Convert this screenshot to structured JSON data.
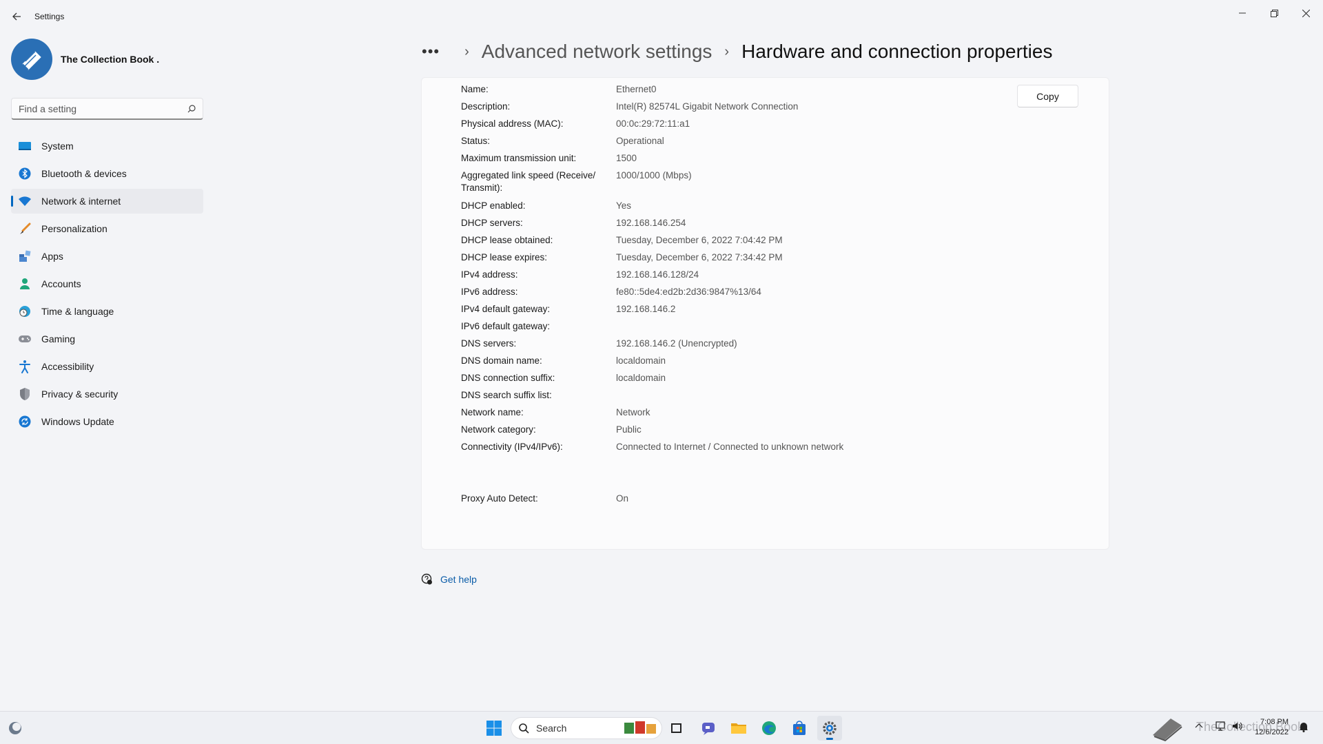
{
  "window": {
    "title": "Settings"
  },
  "profile": {
    "name": "The Collection Book ."
  },
  "search": {
    "placeholder": "Find a setting"
  },
  "nav": {
    "items": [
      {
        "label": "System",
        "icon": "monitor-icon"
      },
      {
        "label": "Bluetooth & devices",
        "icon": "bluetooth-icon"
      },
      {
        "label": "Network & internet",
        "icon": "wifi-icon",
        "active": true
      },
      {
        "label": "Personalization",
        "icon": "brush-icon"
      },
      {
        "label": "Apps",
        "icon": "apps-icon"
      },
      {
        "label": "Accounts",
        "icon": "person-icon"
      },
      {
        "label": "Time & language",
        "icon": "globe-clock-icon"
      },
      {
        "label": "Gaming",
        "icon": "gamepad-icon"
      },
      {
        "label": "Accessibility",
        "icon": "accessibility-icon"
      },
      {
        "label": "Privacy & security",
        "icon": "shield-icon"
      },
      {
        "label": "Windows Update",
        "icon": "update-icon"
      }
    ]
  },
  "breadcrumb": {
    "dots": "•••",
    "parent": "Advanced network settings",
    "current": "Hardware and connection properties"
  },
  "card": {
    "copy_label": "Copy",
    "properties": [
      {
        "label": "Name:",
        "value": "Ethernet0"
      },
      {
        "label": "Description:",
        "value": "Intel(R) 82574L Gigabit Network Connection"
      },
      {
        "label": "Physical address (MAC):",
        "value": "00:0c:29:72:11:a1"
      },
      {
        "label": "Status:",
        "value": "Operational"
      },
      {
        "label": "Maximum transmission unit:",
        "value": "1500"
      },
      {
        "label": "Aggregated link speed (Receive/ Transmit):",
        "value": "1000/1000 (Mbps)"
      },
      {
        "label": "DHCP enabled:",
        "value": "Yes"
      },
      {
        "label": "DHCP servers:",
        "value": "192.168.146.254"
      },
      {
        "label": "DHCP lease obtained:",
        "value": "Tuesday, December 6, 2022 7:04:42 PM"
      },
      {
        "label": "DHCP lease expires:",
        "value": "Tuesday, December 6, 2022 7:34:42 PM"
      },
      {
        "label": "IPv4 address:",
        "value": "192.168.146.128/24"
      },
      {
        "label": "IPv6 address:",
        "value": "fe80::5de4:ed2b:2d36:9847%13/64"
      },
      {
        "label": "IPv4 default gateway:",
        "value": "192.168.146.2"
      },
      {
        "label": "IPv6 default gateway:",
        "value": ""
      },
      {
        "label": "DNS servers:",
        "value": "192.168.146.2 (Unencrypted)"
      },
      {
        "label": "DNS domain name:",
        "value": "localdomain"
      },
      {
        "label": "DNS connection suffix:",
        "value": "localdomain"
      },
      {
        "label": "DNS search suffix list:",
        "value": ""
      },
      {
        "label": "Network name:",
        "value": "Network"
      },
      {
        "label": "Network category:",
        "value": "Public"
      },
      {
        "label": "Connectivity (IPv4/IPv6):",
        "value": "Connected to Internet / Connected to unknown network"
      },
      {
        "label": "Proxy Auto Detect:",
        "value": "On"
      }
    ]
  },
  "help": {
    "label": "Get help"
  },
  "taskbar": {
    "search_label": "Search",
    "time": "7:08 PM",
    "date": "12/6/2022",
    "watermark": "TheCollection Book"
  },
  "colors": {
    "accent": "#0067c0",
    "background": "#f3f4f7",
    "card": "#fbfbfc"
  }
}
